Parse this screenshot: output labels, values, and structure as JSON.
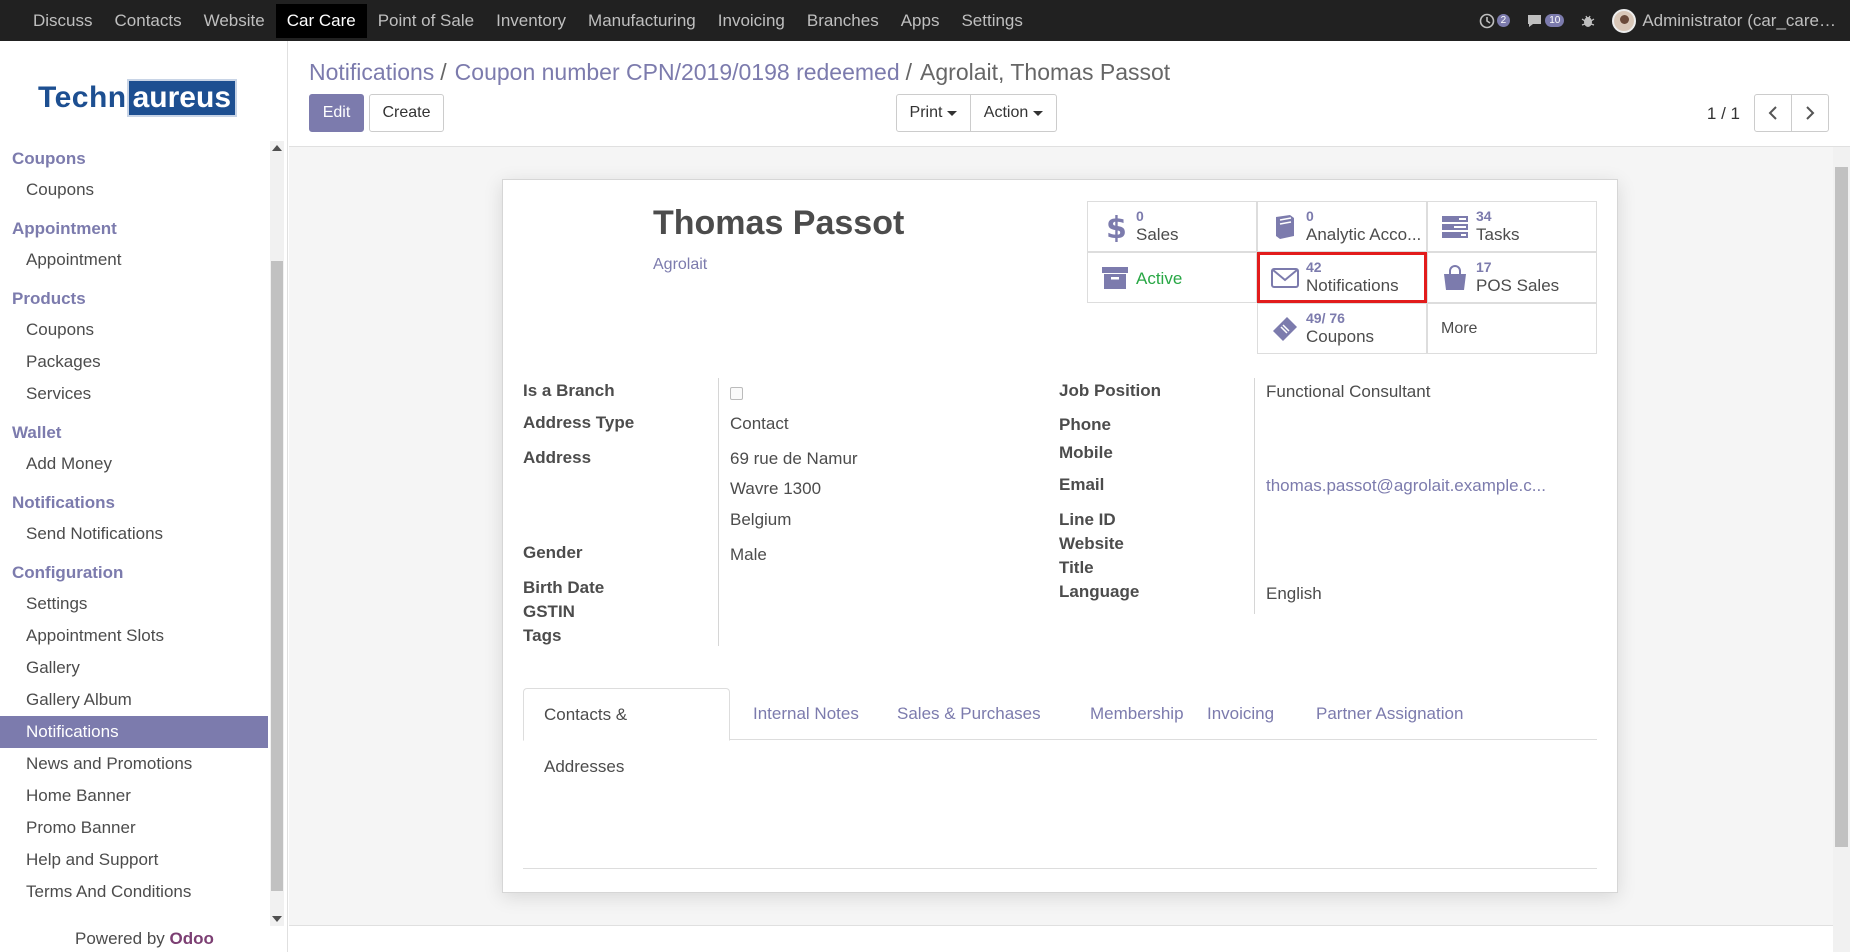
{
  "topbar": {
    "menu": [
      "Discuss",
      "Contacts",
      "Website",
      "Car Care",
      "Point of Sale",
      "Inventory",
      "Manufacturing",
      "Invoicing",
      "Branches",
      "Apps",
      "Settings"
    ],
    "active_menu": "Car Care",
    "activity_count": "2",
    "messages_count": "10",
    "user": "Administrator (car_care…"
  },
  "sidebar": {
    "logo_left": "Techn",
    "logo_right": "aureus",
    "sections": [
      {
        "title": "Coupons",
        "items": [
          "Coupons"
        ]
      },
      {
        "title": "Appointment",
        "items": [
          "Appointment"
        ]
      },
      {
        "title": "Products",
        "items": [
          "Coupons",
          "Packages",
          "Services"
        ]
      },
      {
        "title": "Wallet",
        "items": [
          "Add Money"
        ]
      },
      {
        "title": "Notifications",
        "items": [
          "Send Notifications"
        ]
      },
      {
        "title": "Configuration",
        "items": [
          "Settings",
          "Appointment Slots",
          "Gallery",
          "Gallery Album",
          "Notifications",
          "News and Promotions",
          "Home Banner",
          "Promo Banner",
          "Help and Support",
          "Terms And Conditions"
        ]
      }
    ],
    "active_item": "Notifications",
    "powered_prefix": "Powered by",
    "powered_brand": "Odoo"
  },
  "breadcrumb": {
    "crumb1": "Notifications",
    "crumb2": "Coupon number CPN/2019/0198 redeemed",
    "current": "Agrolait, Thomas Passot",
    "sep": "/"
  },
  "buttons": {
    "edit": "Edit",
    "create": "Create",
    "print": "Print",
    "action": "Action"
  },
  "pager": "1 / 1",
  "record": {
    "name": "Thomas Passot",
    "company": "Agrolait"
  },
  "smart_buttons": {
    "sales": {
      "num": "0",
      "label": "Sales"
    },
    "analytic": {
      "num": "0",
      "label": "Analytic Acco..."
    },
    "tasks": {
      "num": "34",
      "label": "Tasks"
    },
    "active": {
      "label": "Active"
    },
    "notifications": {
      "num": "42",
      "label": "Notifications"
    },
    "pos": {
      "num": "17",
      "label": "POS Sales"
    },
    "coupons": {
      "num": "49/ 76",
      "label": "Coupons"
    },
    "more": {
      "label": "More"
    }
  },
  "fields_left": {
    "is_branch": "Is a Branch",
    "address_type": "Address Type",
    "address_type_val": "Contact",
    "address": "Address",
    "address_l1": "69 rue de Namur",
    "address_l2": "Wavre 1300",
    "address_l3": "Belgium",
    "gender": "Gender",
    "gender_val": "Male",
    "birth_date": "Birth Date",
    "gstin": "GSTIN",
    "tags": "Tags"
  },
  "fields_right": {
    "job_position": "Job Position",
    "job_position_val": "Functional Consultant",
    "phone": "Phone",
    "mobile": "Mobile",
    "email": "Email",
    "email_val": "thomas.passot@agrolait.example.c...",
    "line_id": "Line ID",
    "website": "Website",
    "title": "Title",
    "language": "Language",
    "language_val": "English"
  },
  "tabs": [
    "Contacts & Addresses",
    "Internal Notes",
    "Sales & Purchases",
    "Membership",
    "Invoicing",
    "Partner Assignation"
  ],
  "colors": {
    "brand": "#7c7bad",
    "navbar": "#212121",
    "highlight": "#e21c1c",
    "active_green": "#28a745"
  }
}
